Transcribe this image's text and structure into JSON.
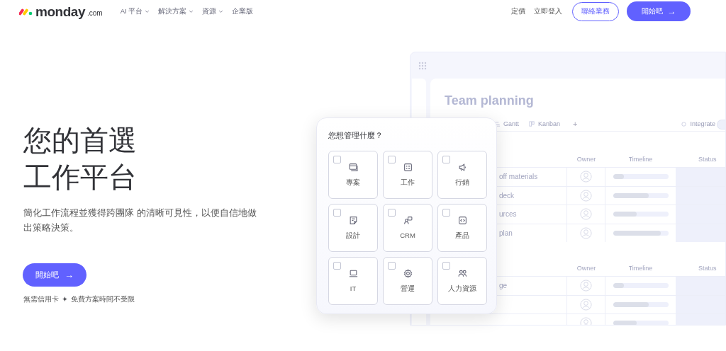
{
  "header": {
    "logo": {
      "name": "monday",
      "suffix": ".com"
    },
    "menu": [
      {
        "label": "AI 平台",
        "dropdown": true
      },
      {
        "label": "解決方案",
        "dropdown": true
      },
      {
        "label": "資源",
        "dropdown": true
      },
      {
        "label": "企業版",
        "dropdown": false
      }
    ],
    "links": [
      "定價",
      "立即登入"
    ],
    "contact_button": "聯絡業務",
    "start_button": {
      "label": "開始吧",
      "arrow": "→"
    }
  },
  "hero": {
    "heading": [
      "您的首選",
      "工作平台"
    ],
    "description": "簡化工作流程並獲得跨團隊 的清晰可見性，以便自信地做出策略決策。",
    "cta": {
      "label": "開始吧",
      "arrow": "→"
    },
    "notes": [
      "無需信用卡",
      "免費方案時間不受限"
    ]
  },
  "picker": {
    "title": "您想管理什麼？",
    "options": [
      {
        "label": "專案",
        "checked": false
      },
      {
        "label": "工作",
        "checked": false
      },
      {
        "label": "行銷",
        "checked": false
      },
      {
        "label": "設計",
        "checked": false
      },
      {
        "label": "CRM",
        "checked": false
      },
      {
        "label": "產品",
        "checked": false
      },
      {
        "label": "IT",
        "checked": false
      },
      {
        "label": "營運",
        "checked": false
      },
      {
        "label": "人力資源",
        "checked": false
      }
    ]
  },
  "board": {
    "title": "Team planning",
    "views": [
      "Gantt",
      "Kanban"
    ],
    "add": "+",
    "integrate": "Integrate",
    "groups": [
      {
        "columns": [
          "Owner",
          "Timeline",
          "Status"
        ],
        "rows": [
          {
            "name": "off materials",
            "level": 0.2
          },
          {
            "name": "deck",
            "level": 0.65
          },
          {
            "name": "urces",
            "level": 0.43
          },
          {
            "name": "plan",
            "level": 0.87
          }
        ]
      },
      {
        "columns": [
          "Owner",
          "Timeline",
          "Status"
        ],
        "rows": [
          {
            "name": "ge",
            "level": 0.2
          },
          {
            "name": "",
            "level": 0.65
          },
          {
            "level": 0.43
          }
        ]
      }
    ]
  }
}
